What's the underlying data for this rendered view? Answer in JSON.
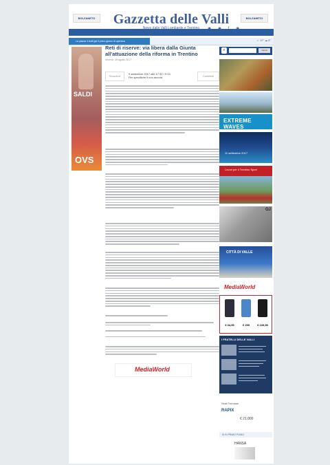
{
  "header": {
    "left_logo": "BOLZANETO",
    "right_logo": "BOLZANETO",
    "title": "Gazzetta delle Valli",
    "subtitle": "News dalle Valli Lombarde e Trentino",
    "social": "◉ ◉ f ◉"
  },
  "nav": {
    "items": [
      "Valli Bresciane",
      "Trento",
      "Alt. di Valli",
      "Ann.",
      "Sc. Studio",
      "Lavoraggi",
      "Cronaca",
      "Sport",
      "Politica",
      "Cronaca",
      "Cultura",
      "Sport"
    ]
  },
  "ticker": {
    "label": "La piazza 4 botti già il primo giorno di apertura",
    "weather": "☼ 12°  ☁ 8°"
  },
  "left_ad": {
    "saldi": "SALDI",
    "brand": "OVS"
  },
  "article": {
    "title": "Reti di riserve: via libera dalla Giunta all'attuazione della riforma in Trentino",
    "date": "Venerdì, 28 agosto 2017",
    "meta_box": "Redazione",
    "byline_1": "9 settembre 2017 alle 17:30 / 9:33",
    "byline_2": "Per specifiche il non ancora",
    "comments": "Commenti",
    "medialogo": "MediaWorld"
  },
  "sidebar": {
    "search_btn": "Cerca",
    "extreme_waves": "EXTREME WAVES",
    "event_text": "11 settembre 2017",
    "red_banner": "Lavori per il Trentino Sport",
    "img7_label": "OJ",
    "img8_label": "CITTÀ DI VALLE",
    "mediaworld": "MediaWorld",
    "prices": [
      "€ 34,99",
      "€ 299",
      "€ 109,99"
    ],
    "eventi_title": "I FRATELLI DELLE VALLI",
    "ad1_hd": "Seat Ferrusse",
    "ad1_logo": "RAPIX",
    "ad1_price": "€ 21.000",
    "ad2_hd": "⚙ IN PRIMO PIANO",
    "ad2_logo": "HANSA"
  },
  "colors": {
    "brand_blue": "#3f5f95",
    "nav_blue": "#2b5da0",
    "mediaworld_red": "#d31f26",
    "page_bg": "#e7ebee"
  }
}
